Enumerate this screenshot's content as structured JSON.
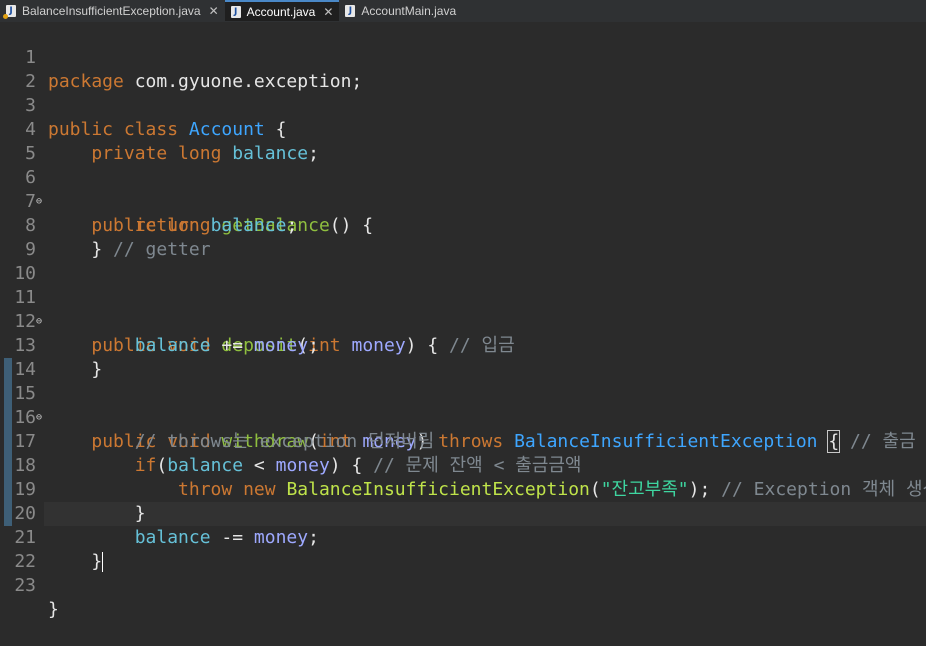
{
  "tabs": [
    {
      "label": "BalanceInsufficientException.java",
      "icon": "java-file-error-icon",
      "closable": true,
      "active": false
    },
    {
      "label": "Account.java",
      "icon": "java-file-icon",
      "closable": true,
      "active": true
    },
    {
      "label": "AccountMain.java",
      "icon": "java-file-icon",
      "closable": false,
      "active": false
    }
  ],
  "file_icon_glyph": "J",
  "close_glyph": "✕",
  "fold_glyph": "⊖",
  "lines": {
    "l1": {
      "num": "1",
      "t": [
        "package",
        " com.gyuone.exception;"
      ]
    },
    "l2": {
      "num": "2"
    },
    "l3": {
      "num": "3",
      "t": [
        "public class",
        " ",
        "Account",
        " {"
      ]
    },
    "l4": {
      "num": "4",
      "t": [
        "    ",
        "private long",
        " ",
        "balance",
        ";"
      ]
    },
    "l5": {
      "num": "5"
    },
    "l6": {
      "num": "6",
      "t": [
        "    ",
        "public long",
        " ",
        "getBalance",
        "() {"
      ]
    },
    "l7": {
      "num": "7",
      "t": [
        "        ",
        "return",
        " ",
        "balance",
        ";"
      ]
    },
    "l8": {
      "num": "8",
      "t": [
        "    ",
        "}",
        " // getter"
      ]
    },
    "l9": {
      "num": "9"
    },
    "l10": {
      "num": "10"
    },
    "l11": {
      "num": "11",
      "t": [
        "    ",
        "public void",
        " ",
        "deposit",
        "(",
        "int",
        " ",
        "money",
        ") { ",
        "// 입금"
      ]
    },
    "l12": {
      "num": "12",
      "t": [
        "        ",
        "balance",
        " += ",
        "money",
        ";"
      ]
    },
    "l13": {
      "num": "13",
      "t": [
        "    ",
        "}"
      ]
    },
    "l14": {
      "num": "14"
    },
    "l15": {
      "num": "15",
      "t": [
        "    ",
        "public void",
        " ",
        "withdraw",
        "(",
        "int",
        " ",
        "money",
        ") ",
        "throws",
        " ",
        "BalanceInsufficientException",
        " ",
        "{",
        " // 출금"
      ]
    },
    "l16": {
      "num": "16",
      "t": [
        "        ",
        "// throws는 exception 던져버림"
      ]
    },
    "l17": {
      "num": "17",
      "t": [
        "        ",
        "if",
        "(",
        "balance",
        " < ",
        "money",
        ") { ",
        "// 문제 잔액 < 출금금액"
      ]
    },
    "l18": {
      "num": "18",
      "t": [
        "            ",
        "throw new",
        " ",
        "BalanceInsufficientException",
        "(",
        "\"잔고부족\"",
        "); ",
        "// Exception 객체 생성"
      ]
    },
    "l19": {
      "num": "19",
      "t": [
        "        ",
        "}"
      ]
    },
    "l20": {
      "num": "20",
      "t": [
        "        ",
        "balance",
        " -= ",
        "money",
        ";"
      ]
    },
    "l21": {
      "num": "21",
      "t": [
        "    ",
        "}"
      ]
    },
    "l22": {
      "num": "22"
    },
    "l23": {
      "num": "23",
      "t": [
        "}"
      ]
    }
  },
  "colors": {
    "keyword": "#cc7832",
    "type_name": "#3ea6ff",
    "method": "#8fbf3f",
    "field": "#66c1d8",
    "parameter": "#9ea9ff",
    "exception_class": "#bfe34a",
    "string": "#3ed6a0",
    "comment": "#7f8890",
    "editor_background": "#2b2b2b",
    "active_tab_accent": "#4a88c7"
  }
}
